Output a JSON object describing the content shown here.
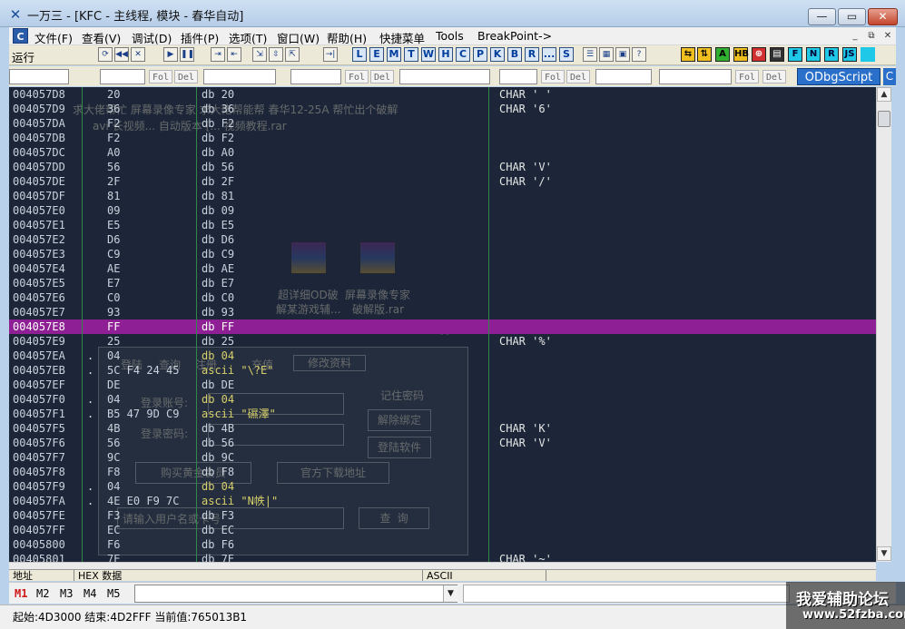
{
  "window": {
    "title": "一万三 - [KFC - 主线程, 模块 - 春华自动]",
    "min_glyph": "—",
    "max_glyph": "▭",
    "close_glyph": "✕",
    "icon": "debugger-app-icon"
  },
  "menu": {
    "logo": "C",
    "items": [
      "文件(F)",
      "查看(V)",
      "调试(D)",
      "插件(P)",
      "选项(T)",
      "窗口(W)",
      "帮助(H)",
      "快捷菜单",
      "Tools",
      "BreakPoint->"
    ],
    "mdi_min": "_",
    "mdi_restore": "⧉",
    "mdi_close": "✕"
  },
  "toolbar": {
    "status": "运行",
    "buttons": [
      "⟳",
      "◀◀",
      "✕",
      "▶",
      "❚❚",
      "⇥",
      "⇤",
      "⇲",
      "⇳",
      "⇱",
      "⇉",
      "→|"
    ],
    "letters": [
      "L",
      "E",
      "M",
      "T",
      "W",
      "H",
      "C",
      "P",
      "K",
      "B",
      "R",
      "...",
      "S"
    ],
    "extra": [
      "☰",
      "▦",
      "▣",
      "?"
    ],
    "plugins": [
      {
        "label": "⇆",
        "bg": "#f0c020",
        "fg": "#000"
      },
      {
        "label": "⇅",
        "bg": "#f0c020",
        "fg": "#000"
      },
      {
        "label": "A",
        "bg": "#30b030",
        "fg": "#000"
      },
      {
        "label": "HB",
        "bg": "#f0c020",
        "fg": "#000"
      },
      {
        "label": "⊕",
        "bg": "#d03030",
        "fg": "#fff"
      },
      {
        "label": "▤",
        "bg": "#303030",
        "fg": "#fff"
      },
      {
        "label": "F",
        "bg": "#20c8e8",
        "fg": "#003"
      },
      {
        "label": "N",
        "bg": "#20c8e8",
        "fg": "#003"
      },
      {
        "label": "R",
        "bg": "#20c8e8",
        "fg": "#003"
      },
      {
        "label": "JS",
        "bg": "#20c8e8",
        "fg": "#003"
      }
    ]
  },
  "cmdbar": {
    "tags": [
      "Fol",
      "Del",
      "Fol",
      "Del",
      "Fol",
      "Del",
      "Fol",
      "Del"
    ],
    "script_label": "ODbgScript",
    "end_label": "C"
  },
  "dump": {
    "rows": [
      {
        "addr": "004057D8",
        "mark": "",
        "hex": "20",
        "dis": "db 20",
        "com": "CHAR ' '"
      },
      {
        "addr": "004057D9",
        "mark": "",
        "hex": "36",
        "dis": "db 36",
        "com": "CHAR '6'"
      },
      {
        "addr": "004057DA",
        "mark": "",
        "hex": "F2",
        "dis": "db F2",
        "com": ""
      },
      {
        "addr": "004057DB",
        "mark": "",
        "hex": "F2",
        "dis": "db F2",
        "com": ""
      },
      {
        "addr": "004057DC",
        "mark": "",
        "hex": "A0",
        "dis": "db A0",
        "com": ""
      },
      {
        "addr": "004057DD",
        "mark": "",
        "hex": "56",
        "dis": "db 56",
        "com": "CHAR 'V'"
      },
      {
        "addr": "004057DE",
        "mark": "",
        "hex": "2F",
        "dis": "db 2F",
        "com": "CHAR '/'"
      },
      {
        "addr": "004057DF",
        "mark": "",
        "hex": "81",
        "dis": "db 81",
        "com": ""
      },
      {
        "addr": "004057E0",
        "mark": "",
        "hex": "09",
        "dis": "db 09",
        "com": ""
      },
      {
        "addr": "004057E1",
        "mark": "",
        "hex": "E5",
        "dis": "db E5",
        "com": ""
      },
      {
        "addr": "004057E2",
        "mark": "",
        "hex": "D6",
        "dis": "db D6",
        "com": ""
      },
      {
        "addr": "004057E3",
        "mark": "",
        "hex": "C9",
        "dis": "db C9",
        "com": ""
      },
      {
        "addr": "004057E4",
        "mark": "",
        "hex": "AE",
        "dis": "db AE",
        "com": ""
      },
      {
        "addr": "004057E5",
        "mark": "",
        "hex": "E7",
        "dis": "db E7",
        "com": ""
      },
      {
        "addr": "004057E6",
        "mark": "",
        "hex": "C0",
        "dis": "db C0",
        "com": ""
      },
      {
        "addr": "004057E7",
        "mark": "",
        "hex": "93",
        "dis": "db 93",
        "com": ""
      },
      {
        "addr": "004057E8",
        "mark": "",
        "hex": "FF",
        "dis": "db FF",
        "com": "",
        "selected": true
      },
      {
        "addr": "004057E9",
        "mark": "",
        "hex": "25",
        "dis": "db 25",
        "com": "CHAR '%'"
      },
      {
        "addr": "004057EA",
        "mark": ".",
        "hex": "04",
        "dis": "db 04",
        "com": "",
        "style": "db04"
      },
      {
        "addr": "004057EB",
        "mark": ".",
        "hex": "5C F4 24 45",
        "dis": "ascii \"\\?E\"",
        "com": "",
        "style": "ascii"
      },
      {
        "addr": "004057EF",
        "mark": "",
        "hex": "DE",
        "dis": "db DE",
        "com": ""
      },
      {
        "addr": "004057F0",
        "mark": ".",
        "hex": "04",
        "dis": "db 04",
        "com": "",
        "style": "db04"
      },
      {
        "addr": "004057F1",
        "mark": ".",
        "hex": "B5 47 9D C9",
        "dis": "ascii \"礘澤\"",
        "com": "",
        "style": "ascii"
      },
      {
        "addr": "004057F5",
        "mark": "",
        "hex": "4B",
        "dis": "db 4B",
        "com": "CHAR 'K'"
      },
      {
        "addr": "004057F6",
        "mark": "",
        "hex": "56",
        "dis": "db 56",
        "com": "CHAR 'V'"
      },
      {
        "addr": "004057F7",
        "mark": "",
        "hex": "9C",
        "dis": "db 9C",
        "com": ""
      },
      {
        "addr": "004057F8",
        "mark": "",
        "hex": "F8",
        "dis": "db F8",
        "com": ""
      },
      {
        "addr": "004057F9",
        "mark": ".",
        "hex": "04",
        "dis": "db 04",
        "com": "",
        "style": "db04"
      },
      {
        "addr": "004057FA",
        "mark": ".",
        "hex": "4E E0 F9 7C",
        "dis": "ascii \"N帙|\"",
        "com": "",
        "style": "ascii"
      },
      {
        "addr": "004057FE",
        "mark": "",
        "hex": "F3",
        "dis": "db F3",
        "com": ""
      },
      {
        "addr": "004057FF",
        "mark": "",
        "hex": "EC",
        "dis": "db EC",
        "com": ""
      },
      {
        "addr": "00405800",
        "mark": "",
        "hex": "F6",
        "dis": "db F6",
        "com": ""
      },
      {
        "addr": "00405801",
        "mark": "",
        "hex": "7E",
        "dis": "db 7E",
        "com": "CHAR '~'"
      }
    ]
  },
  "ghost": {
    "top_text_1": "求大佬帮忙  屏幕录像专家  求大佬帮能帮  春华12-25A  帮忙出个破解",
    "top_text_2": "avi  长视频...  自动版本 [...  视频教程.rar",
    "rar1_line1": "超详细OD破",
    "rar1_line2": "解某游戏辅...",
    "rar2_line1": "屏幕录像专家",
    "rar2_line2": "破解版.rar",
    "dialog": {
      "tabs": [
        "登陆",
        "查询",
        "注册",
        "充值",
        "修改资料"
      ],
      "account_label": "登录账号:",
      "password_label": "登录密码:",
      "remember": "记住密码",
      "unbind": "解除绑定",
      "login": "登陆软件",
      "buy": "购买黄金会员",
      "download": "官方下载地址",
      "query_placeholder": "请输入用户名或卡号",
      "query": "查 询",
      "close": "✕"
    }
  },
  "columns": {
    "addr": "地址",
    "hex": "HEX 数据",
    "ascii": "ASCII"
  },
  "markers": [
    "M1",
    "M2",
    "M3",
    "M4",
    "M5"
  ],
  "expr_drop": "▼",
  "status": "起始:4D3000 结束:4D2FFF 当前值:765013B1",
  "watermark": {
    "line1": "我爱辅助论坛",
    "line2": "www.52fzba.com"
  }
}
